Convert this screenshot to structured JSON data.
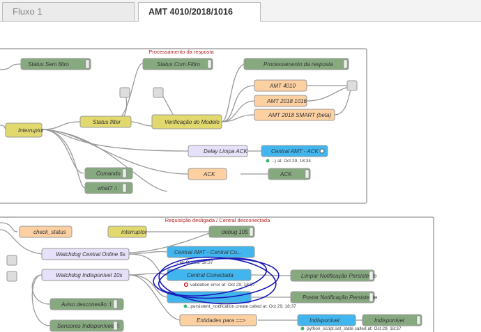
{
  "tabs": [
    {
      "label": "Fluxo 1",
      "active": false
    },
    {
      "label": "AMT 4010/2018/1016",
      "active": true
    }
  ],
  "groups": {
    "processamento": "Processamento da resposta",
    "requisicao": "Requisição desligada / Central desconectada"
  },
  "nodes": {
    "status_sem_filtro": "Status Sem filtro",
    "status_com_filtro": "Status Com Filtro",
    "processamento_resposta": "Processamento da resposta",
    "amt_4010": "AMT 4010",
    "amt_2018_1016": "AMT 2018 1016",
    "amt_2018_smart": "AMT 2018 SMART (beta)",
    "interruptor": "Interruptor",
    "status_filter": "Status filter",
    "verificacao_modelo": "Verificação do Modelo",
    "delay_limpa_ack": "Delay Limpa ACK",
    "central_amt_ack": "Central AMT - ACK",
    "ack_function": "ACK",
    "ack_debug": "ACK",
    "comando": "Comando",
    "what": "what? :\\",
    "check_status": "check_status",
    "interruptor2": "interruptor",
    "debug_105": "debug 105",
    "watchdog_online": "Watchdog Central Online 5s",
    "watchdog_indisponivel": "Watchdog Indisponivel 10s",
    "central_amt_partial": "Central AMT - Central Co...",
    "central_conectada": "Central Conectada",
    "limpar_notificacao": "Limpar Notificação Persistente",
    "postar_notificacao": "Postar Notificação Persistente",
    "aviso_desconexao": "Aviso desconexão :\\",
    "entidades_para": "Entidades para ==>",
    "indisponivel_service": "Indisponível",
    "indisponivel_debug": "Indisponível",
    "sensores_indisponiveis": "Sensores Indisponíveis :\\"
  },
  "statuses": {
    "ack_ok": ":-) at: Oct 29, 18:34",
    "central_partial": "...at: Oct 29, 18:37",
    "validation_error": "validation error at: Oct 29, 18:37",
    "notification_create": "...persistent_notification.create called at: Oct 29, 18:37",
    "python_script": "python_script.set_state called at: Oct 29, 18:37"
  },
  "colors": {
    "function": "#fdd0a2",
    "debug": "#87a980",
    "switch": "#e2d96e",
    "delay": "#e6e0f8",
    "ha": "#41b5ee",
    "link": "#dddddd",
    "group_border": "#777777",
    "group_label": "#b22222",
    "wire": "#999999",
    "annotation": "#1a1ab8"
  }
}
